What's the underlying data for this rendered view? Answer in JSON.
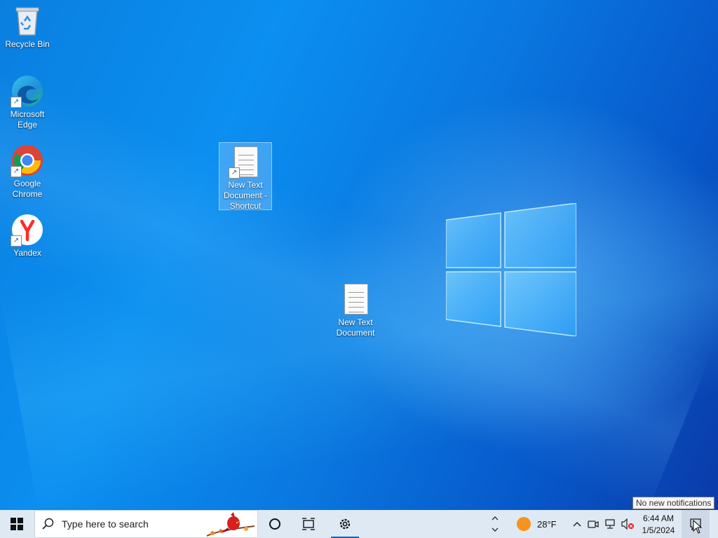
{
  "desktop": {
    "icons": [
      {
        "label": "Recycle Bin",
        "icon": "recycle-bin-icon"
      },
      {
        "label": "Microsoft Edge",
        "icon": "edge-icon"
      },
      {
        "label": "Google Chrome",
        "icon": "chrome-icon"
      },
      {
        "label": "Yandex",
        "icon": "yandex-icon"
      },
      {
        "label": "New Text Document - Shortcut",
        "icon": "text-document-shortcut-icon",
        "selected": true
      },
      {
        "label": "New Text Document",
        "icon": "text-document-icon"
      }
    ]
  },
  "taskbar": {
    "search_placeholder": "Type here to search",
    "weather": {
      "temp": "28°F",
      "icon": "weather-sun-icon"
    },
    "clock": {
      "time": "6:44 AM",
      "date": "1/5/2024"
    },
    "tray_icons": [
      "chevron-up-icon",
      "meet-now-icon",
      "network-icon",
      "volume-muted-icon"
    ],
    "notification_tooltip": "No new notifications"
  },
  "colors": {
    "desktop_blue": "#0a7fe0",
    "taskbar_bg": "#dfe9f3",
    "accent": "#0067c0"
  }
}
